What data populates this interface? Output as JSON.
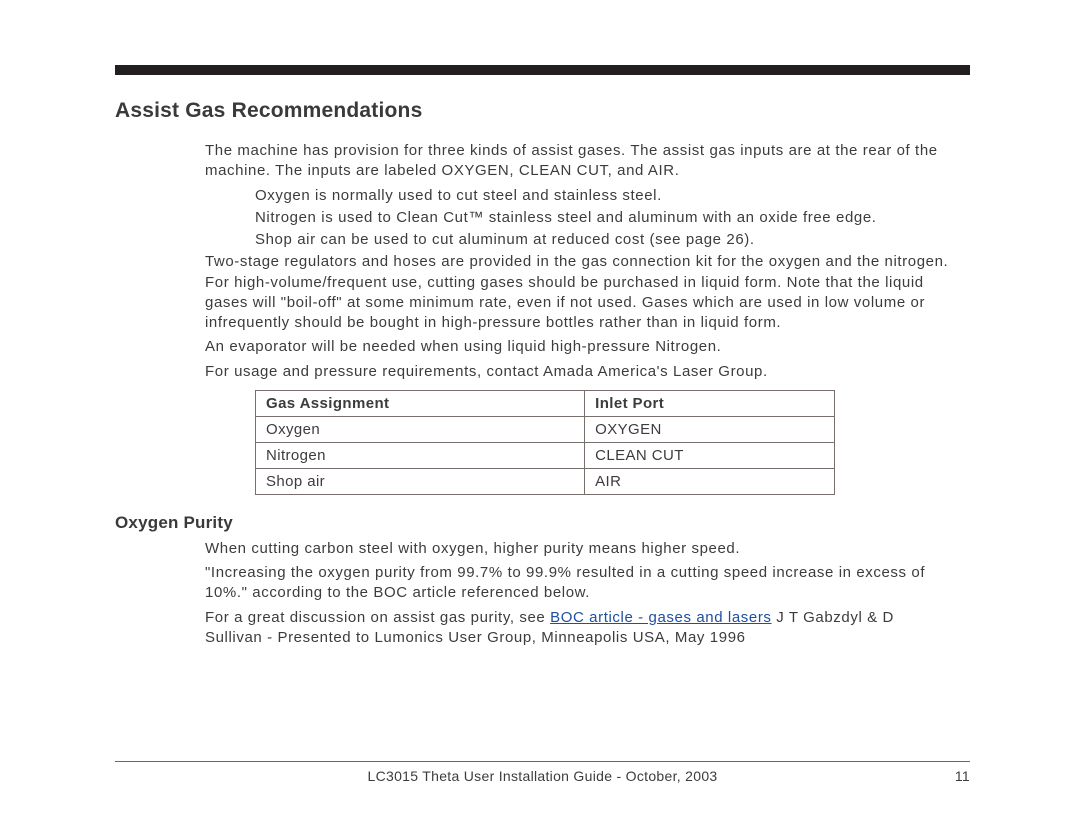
{
  "heading": "Assist Gas Recommendations",
  "p1": "The machine has provision for three kinds of assist gases. The assist gas inputs are at the rear of the machine. The inputs are labeled OXYGEN, CLEAN CUT, and AIR.",
  "bul1": "Oxygen is normally used to cut steel and stainless steel.",
  "bul2": "Nitrogen is used to Clean Cut™ stainless steel and aluminum with an oxide free edge.",
  "bul3": "Shop air can be used to cut aluminum at reduced cost (see page 26).",
  "p2": "Two-stage regulators and hoses are provided in the gas connection kit for the oxygen and the nitrogen. For high-volume/frequent use, cutting gases should be purchased in liquid form. Note that the liquid gases will \"boil-off\" at some minimum rate, even if not used. Gases which are used in low volume or infrequently should be bought in high-pressure bottles rather than in liquid form.",
  "p3": "An evaporator will be needed when using liquid high-pressure Nitrogen.",
  "p4": "For usage and pressure requirements, contact Amada America's Laser Group.",
  "table": {
    "head": {
      "c1": "Gas Assignment",
      "c2": "Inlet Port"
    },
    "rows": [
      {
        "c1": "Oxygen",
        "c2": "OXYGEN"
      },
      {
        "c1": "Nitrogen",
        "c2": "CLEAN CUT"
      },
      {
        "c1": "Shop air",
        "c2": "AIR"
      }
    ]
  },
  "sub": "Oxygen Purity",
  "op1": "When cutting carbon steel with oxygen, higher purity means higher speed.",
  "op2": "\"Increasing the oxygen purity from 99.7% to 99.9% resulted in a cutting speed increase in excess of 10%.\" according to the BOC article referenced below.",
  "op3a": "For a great discussion on assist gas purity, see ",
  "op3_link": "BOC article - gases and lasers",
  "op3b": "  J T Gabzdyl & D Sullivan - Presented to Lumonics User Group, Minneapolis USA, May 1996",
  "footer_title": "LC3015 Theta User Installation Guide - October, 2003",
  "footer_page": "11"
}
